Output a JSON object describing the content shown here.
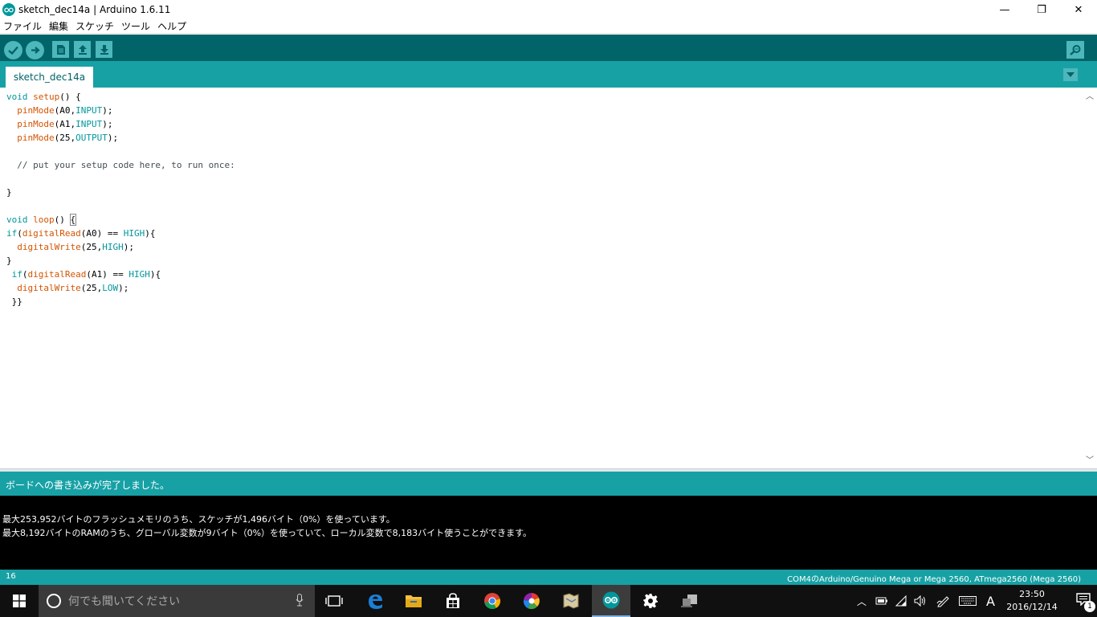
{
  "window": {
    "title": "sketch_dec14a | Arduino 1.6.11",
    "controls": {
      "minimize": "—",
      "restore": "❐",
      "close": "✕"
    }
  },
  "menu": {
    "items": [
      "ファイル",
      "編集",
      "スケッチ",
      "ツール",
      "ヘルプ"
    ]
  },
  "toolbar": {
    "buttons": [
      "verify-icon",
      "upload-icon",
      "new-icon",
      "open-icon",
      "save-icon",
      "serial-monitor-icon"
    ]
  },
  "tabs": {
    "active": "sketch_dec14a"
  },
  "status": {
    "message": "ボードへの書き込みが完了しました。"
  },
  "console": {
    "lines": [
      "最大253,952バイトのフラッシュメモリのうち、スケッチが1,496バイト（0%）を使っています。",
      "最大8,192バイトのRAMのうち、グローバル変数が9バイト（0%）を使っていて、ローカル変数で8,183バイト使うことができます。"
    ]
  },
  "footer": {
    "line_number": "16",
    "board": "COM4のArduino/Genuino Mega or Mega 2560, ATmega2560 (Mega 2560)"
  },
  "taskbar": {
    "search_placeholder": "何でも聞いてください",
    "ime": "A",
    "time": "23:50",
    "date": "2016/12/14",
    "notification_count": "1"
  },
  "colors": {
    "toolbar": "#006468",
    "tabbar": "#17a1a5",
    "accent_button": "#4db7bb",
    "keyword": "#00979c",
    "function": "#d35400"
  }
}
